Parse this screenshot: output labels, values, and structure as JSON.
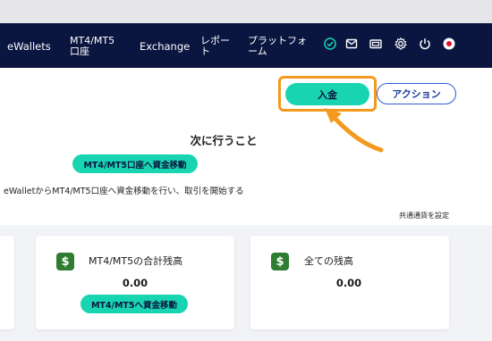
{
  "navbar": {
    "items": [
      {
        "label": "eWallets"
      },
      {
        "label_line1": "MT4/MT5",
        "label_line2": "口座"
      },
      {
        "label": "Exchange"
      },
      {
        "label_line1": "レポー",
        "label_line2": "ト"
      },
      {
        "label_line1": "プラットフォ",
        "label_line2": "ーム"
      }
    ],
    "icons": [
      "verified-check-icon",
      "mail-icon",
      "wallet-card-icon",
      "gear-icon",
      "power-icon",
      "japan-flag-icon"
    ],
    "colors": {
      "background": "#0b1640",
      "accent": "#19d4b0"
    }
  },
  "actions": {
    "deposit_label": "入金",
    "action_label": "アクション",
    "highlight_color": "#f39a1e"
  },
  "next_steps": {
    "title": "次に行うこと",
    "button_label": "MT4/MT5口座へ資金移動",
    "description": "eWalletからMT4/MT5口座へ資金移動を行い、取引を開始する"
  },
  "currency_link": "共通通貨を設定",
  "cards": [
    {
      "label": "MT4/MT5の合計残高",
      "value": "0.00",
      "button_label": "MT4/MT5へ資金移動"
    },
    {
      "label": "全ての残高",
      "value": "0.00"
    }
  ]
}
